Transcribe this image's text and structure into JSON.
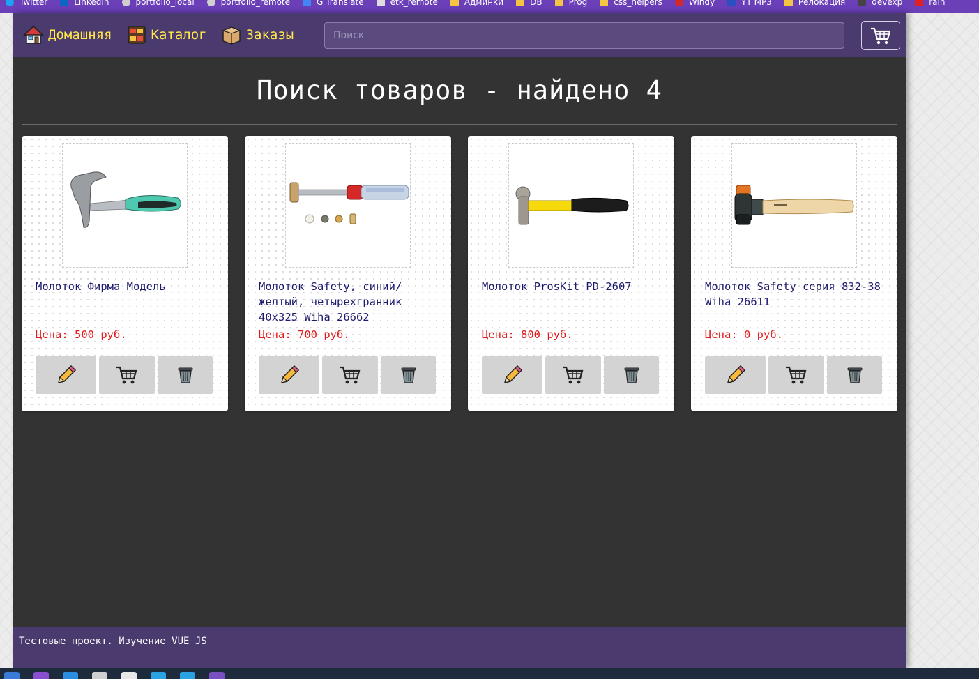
{
  "browser": {
    "bookmarks": [
      {
        "label": "Twitter",
        "color": "#1da1f2"
      },
      {
        "label": "LinkedIn",
        "color": "#0a66c2"
      },
      {
        "label": "portfolio_local",
        "color": "#cfcfcf"
      },
      {
        "label": "portfolio_remote",
        "color": "#cfcfcf"
      },
      {
        "label": "G Translate",
        "color": "#4285f4"
      },
      {
        "label": "etk_remote",
        "color": "#dddddd"
      },
      {
        "label": "Админки",
        "color": "#f4c542"
      },
      {
        "label": "DB",
        "color": "#f4c542"
      },
      {
        "label": "Prog",
        "color": "#f4c542"
      },
      {
        "label": "css_helpers",
        "color": "#f4c542"
      },
      {
        "label": "Windy",
        "color": "#d62828"
      },
      {
        "label": "YT MP3",
        "color": "#2a4fbf"
      },
      {
        "label": "Релокация",
        "color": "#f4c542"
      },
      {
        "label": "devexp",
        "color": "#444444"
      },
      {
        "label": "rain",
        "color": "#e02020"
      }
    ]
  },
  "nav": {
    "home": "Домашняя",
    "catalog": "Каталог",
    "orders": "Заказы"
  },
  "search": {
    "placeholder": "Поиск",
    "value": ""
  },
  "page": {
    "title": "Поиск товаров - найдено 4"
  },
  "products": [
    {
      "name": "Молоток Фирма Модель",
      "price": "Цена: 500 руб.",
      "image": "claw-hammer-green-grip"
    },
    {
      "name": "Молоток Safety, синий/желтый, четырехгранник 40x325 Wiha 26662",
      "price": "Цена: 700 руб.",
      "image": "screwdriver-hammer-kit"
    },
    {
      "name": "Молоток ProsKit PD-2607",
      "price": "Цена: 800 руб.",
      "image": "ball-peen-hammer-yellow"
    },
    {
      "name": "Молоток Safety серия 832-38 Wiha 26611",
      "price": "Цена: 0 руб.",
      "image": "soft-face-mallet-wood"
    }
  ],
  "footer": {
    "text": "Тестовые проект. Изучение VUE JS"
  },
  "colors": {
    "navbar": "#4a3a6e",
    "content": "#333333",
    "nav_link": "#ffe84a",
    "product_name": "#1c1a6e",
    "price": "#e01a1a",
    "action_button": "#d3d3d3"
  }
}
